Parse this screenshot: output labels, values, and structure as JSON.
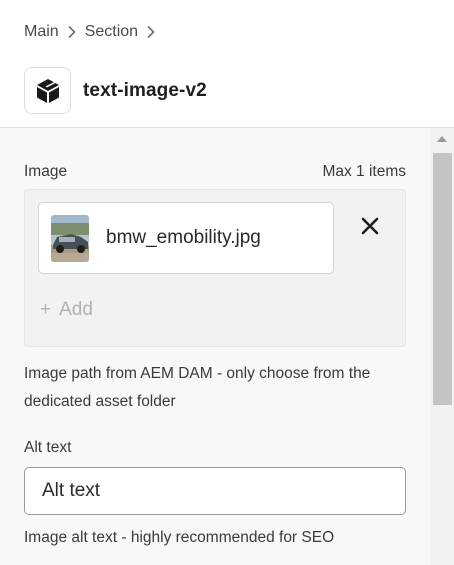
{
  "breadcrumb": {
    "items": [
      "Main",
      "Section"
    ]
  },
  "component": {
    "title": "text-image-v2",
    "icon": "cube-icon"
  },
  "image_field": {
    "label": "Image",
    "max_items_label": "Max 1 items",
    "file_name": "bmw_emobility.jpg",
    "add_label": "Add",
    "help_text": "Image path from AEM DAM - only choose from the dedicated asset folder"
  },
  "alt_field": {
    "label": "Alt text",
    "placeholder": "Alt text",
    "help_text": "Image alt text - highly recommended for SEO"
  },
  "colors": {
    "panel_bg": "#f8f8f8",
    "image_box_bg": "#f2f2f2",
    "scroll_thumb": "#c4c4c4"
  }
}
